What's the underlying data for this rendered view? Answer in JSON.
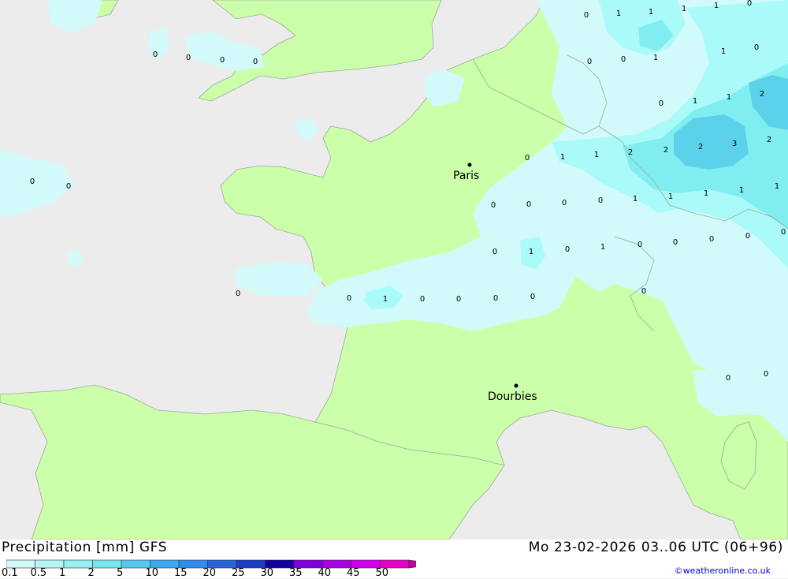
{
  "footer": {
    "title": "Precipitation [mm] GFS",
    "datetime": "Mo 23-02-2026 03..06 UTC (06+96)",
    "credit": "©weatheronline.co.uk"
  },
  "legend": {
    "ticks": [
      "0.1",
      "0.5",
      "1",
      "2",
      "5",
      "10",
      "15",
      "20",
      "25",
      "30",
      "35",
      "40",
      "45",
      "50"
    ],
    "colors": [
      "#d2fafa",
      "#b4f5f5",
      "#96f0f0",
      "#78e6f0",
      "#55c8f0",
      "#3caaf0",
      "#328cf0",
      "#2864dc",
      "#1e3cc8",
      "#1400a0",
      "#8200dc",
      "#aa00e6",
      "#d200f0",
      "#e600c8",
      "#be00a0"
    ]
  },
  "colors": {
    "sea": "#ececec",
    "land": "#ccff aa",
    "precip_light": "#d2fafa",
    "precip_mid": "#aafafa",
    "precip_high": "#80eef0",
    "precip_max": "#5cd2ea"
  },
  "cities": [
    {
      "name": "Paris"
    },
    {
      "name": "Dourbies"
    }
  ],
  "precip_values": [
    "0",
    "1",
    "1",
    "1",
    "1",
    "0",
    "0",
    "0",
    "0",
    "1",
    "1",
    "0",
    "0",
    "0",
    "0",
    "0",
    "0",
    "1",
    "2",
    "1",
    "1",
    "2",
    "2",
    "2",
    "3",
    "2",
    "0",
    "0",
    "1",
    "1",
    "1",
    "1",
    "1",
    "1",
    "0",
    "0",
    "0",
    "0",
    "1",
    "0",
    "0",
    "1",
    "0",
    "0",
    "0",
    "0",
    "0",
    "0",
    "0",
    "0",
    "1",
    "0",
    "0",
    "0",
    "0",
    "0",
    "0",
    "0"
  ]
}
